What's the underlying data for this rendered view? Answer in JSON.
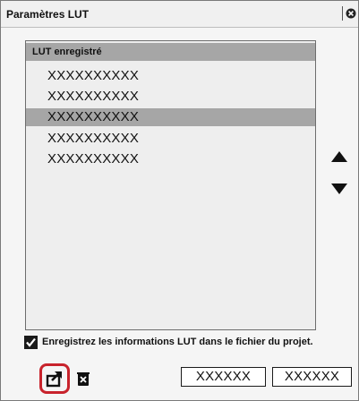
{
  "dialog": {
    "title": "Paramètres LUT",
    "close_icon": "close-circle-icon"
  },
  "lut_list": {
    "header": "LUT enregistré",
    "items": [
      "XXXXXXXXXX",
      "XXXXXXXXXX",
      "XXXXXXXXXX",
      "XXXXXXXXXX",
      "XXXXXXXXXX"
    ],
    "selected_index": 2
  },
  "reorder": {
    "up_icon": "triangle-up-icon",
    "down_icon": "triangle-down-icon"
  },
  "save_option": {
    "checked": true,
    "label": "Enregistrez les informations LUT dans le fichier du projet."
  },
  "toolbar": {
    "import_icon": "import-icon",
    "delete_icon": "delete-icon",
    "button1_label": "XXXXXX",
    "button2_label": "XXXXXX"
  },
  "colors": {
    "highlight": "#c8232c",
    "selection": "#a6a6a6"
  }
}
